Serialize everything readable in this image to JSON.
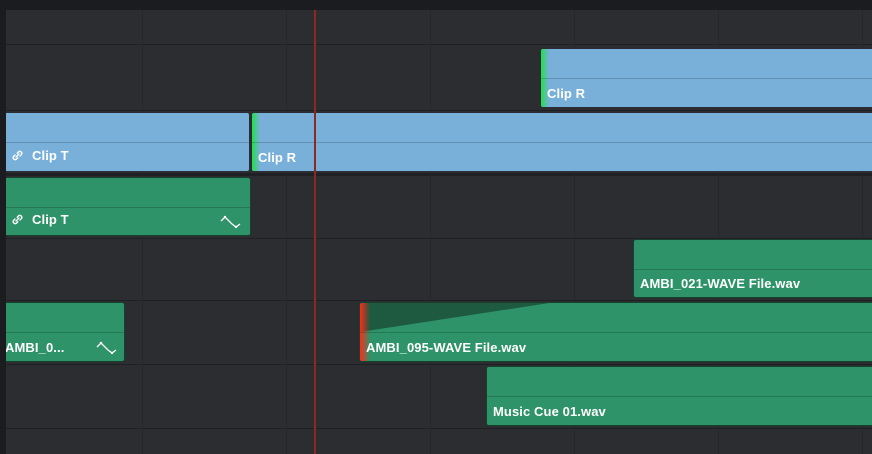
{
  "timeline": {
    "clips": {
      "video_upper_clip_r": {
        "label": "Clip R"
      },
      "video_main_clip_t": {
        "label": "Clip T",
        "linked": true
      },
      "video_main_clip_r": {
        "label": "Clip R"
      },
      "audio1_clip_t": {
        "label": "Clip T",
        "linked": true
      },
      "audio_ambi_021": {
        "label": "AMBI_021-WAVE File.wav"
      },
      "audio_ambi_0": {
        "label": "AMBI_0..."
      },
      "audio_ambi_095": {
        "label": "AMBI_095-WAVE File.wav"
      },
      "audio_music_cue": {
        "label": "Music Cue 01.wav"
      }
    },
    "icons": {
      "link": "link-icon",
      "fade": "fade-curve-icon"
    },
    "colors": {
      "video_clip": "#79b0da",
      "audio_clip": "#2e9368",
      "playhead": "#8a2a22",
      "background": "#2b2d31"
    }
  }
}
